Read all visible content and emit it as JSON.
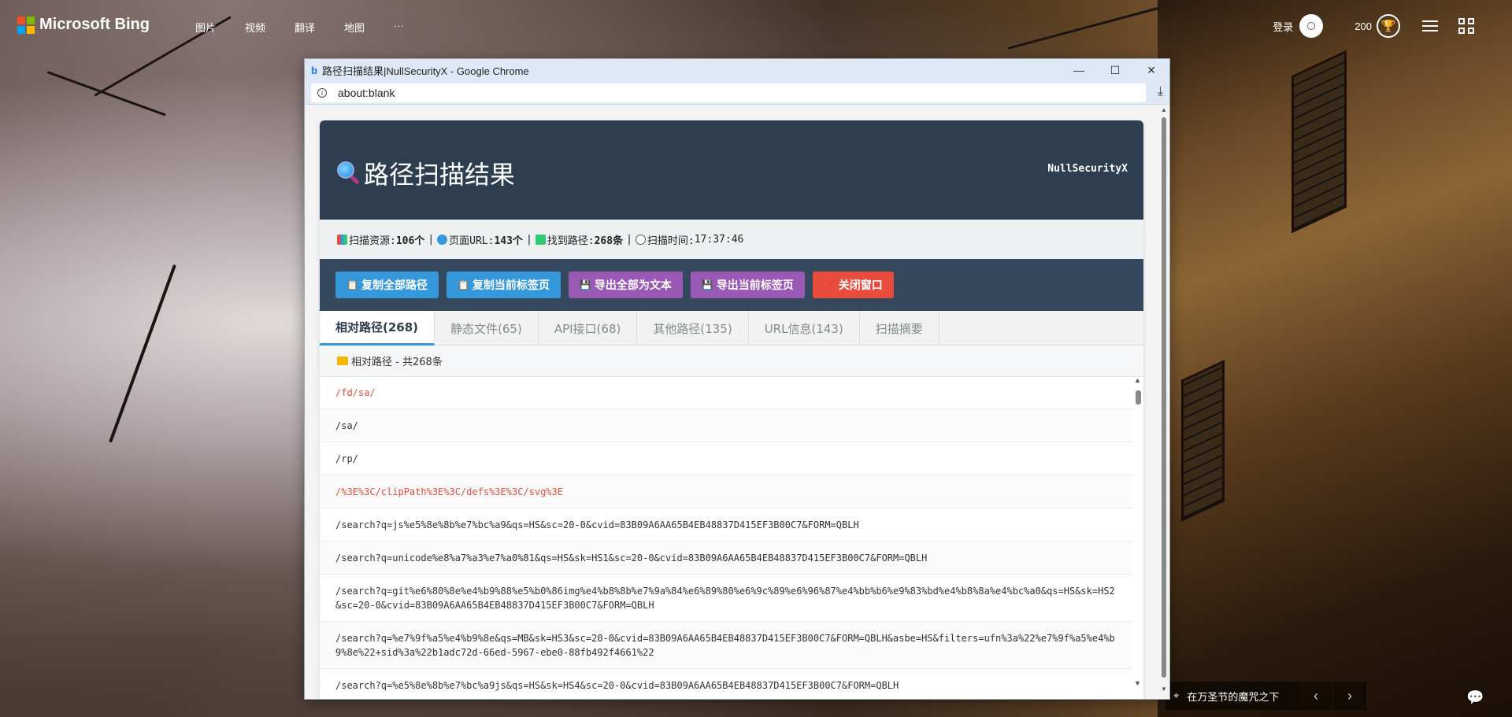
{
  "bing": {
    "logo_text": "Microsoft Bing",
    "nav": [
      "图片",
      "视频",
      "翻译",
      "地图",
      "···"
    ],
    "login": "登录",
    "points": "200",
    "caption": "在万圣节的魔咒之下"
  },
  "chrome": {
    "title": "路径扫描结果|NullSecurityX - Google Chrome",
    "url": "about:blank",
    "controls": {
      "minimize": "—",
      "maximize": "☐",
      "close": "✕"
    }
  },
  "app": {
    "title": "路径扫描结果",
    "brand": "NullSecurityX",
    "stats": {
      "resources_label": "扫描资源:",
      "resources_value": "106个",
      "urls_label": "页面URL:",
      "urls_value": "143个",
      "paths_label": "找到路径:",
      "paths_value": "268条",
      "time_label": "扫描时间:",
      "time_value": "17:37:46"
    },
    "buttons": {
      "copy_all": "复制全部路径",
      "copy_tab": "复制当前标签页",
      "export_all": "导出全部为文本",
      "export_tab": "导出当前标签页",
      "close": "关闭窗口"
    },
    "tabs": [
      "相对路径(268)",
      "静态文件(65)",
      "API接口(68)",
      "其他路径(135)",
      "URL信息(143)",
      "扫描摘要"
    ],
    "section_title": "相对路径 - 共268条",
    "rows": [
      {
        "text": "/fd/sa/",
        "highlight": true
      },
      {
        "text": "/sa/",
        "highlight": false
      },
      {
        "text": "/rp/",
        "highlight": false
      },
      {
        "text": "/%3E%3C/clipPath%3E%3C/defs%3E%3C/svg%3E",
        "highlight": true
      },
      {
        "text": "/search?q=js%e5%8e%8b%e7%bc%a9&qs=HS&sc=20-0&cvid=83B09A6AA65B4EB48837D415EF3B00C7&FORM=QBLH",
        "highlight": false
      },
      {
        "text": "/search?q=unicode%e8%a7%a3%e7%a0%81&qs=HS&sk=HS1&sc=20-0&cvid=83B09A6AA65B4EB48837D415EF3B00C7&FORM=QBLH",
        "highlight": false
      },
      {
        "text": "/search?q=git%e6%80%8e%e4%b9%88%e5%b0%86img%e4%b8%8b%e7%9a%84%e6%89%80%e6%9c%89%e6%96%87%e4%bb%b6%e9%83%bd%e4%b8%8a%e4%bc%a0&qs=HS&sk=HS2&sc=20-0&cvid=83B09A6AA65B4EB48837D415EF3B00C7&FORM=QBLH",
        "highlight": false
      },
      {
        "text": "/search?q=%e7%9f%a5%e4%b9%8e&qs=MB&sk=HS3&sc=20-0&cvid=83B09A6AA65B4EB48837D415EF3B00C7&FORM=QBLH&asbe=HS&filters=ufn%3a%22%e7%9f%a5%e4%b9%8e%22+sid%3a%22b1adc72d-66ed-5967-ebe0-88fb492f4661%22",
        "highlight": false
      },
      {
        "text": "/search?q=%e5%8e%8b%e7%bc%a9js&qs=HS&sk=HS4&sc=20-0&cvid=83B09A6AA65B4EB48837D415EF3B00C7&FORM=QBLH",
        "highlight": false
      }
    ]
  },
  "colors": {
    "header_bg": "#2c3e50",
    "toolbar_bg": "#34495e",
    "blue": "#3498db",
    "purple": "#9b59b6",
    "red": "#e74c3c"
  }
}
